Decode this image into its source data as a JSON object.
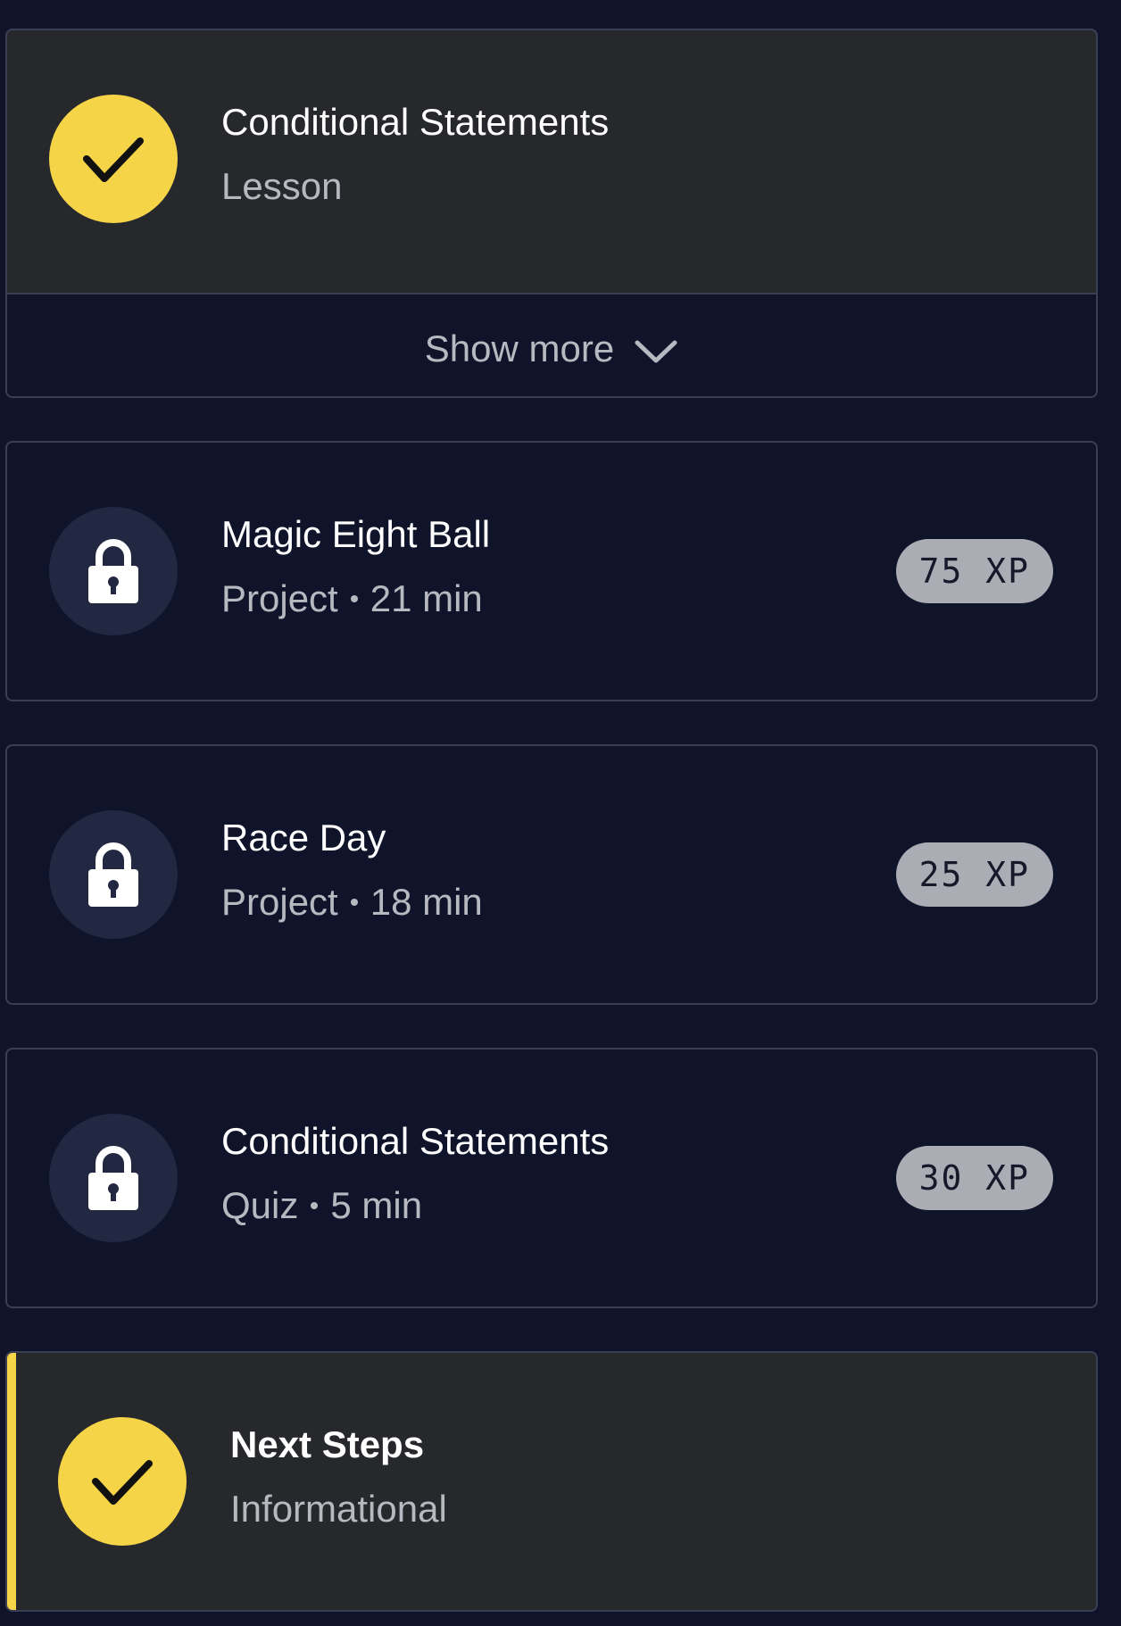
{
  "colors": {
    "page_bg": "#10142a",
    "completed_card_bg": "#27282c",
    "accent_yellow": "#f5d547",
    "lock_circle_bg": "#232842",
    "xp_badge_bg": "#acadb4",
    "border": "#3a3f55"
  },
  "items": [
    {
      "title": "Conditional Statements",
      "subtitle": "Lesson",
      "status": "completed",
      "icon": "checkmark-icon"
    },
    {
      "title": "Magic Eight Ball",
      "type": "Project",
      "duration": "21 min",
      "xp": "75 XP",
      "status": "locked",
      "icon": "lock-icon"
    },
    {
      "title": "Race Day",
      "type": "Project",
      "duration": "18 min",
      "xp": "25 XP",
      "status": "locked",
      "icon": "lock-icon"
    },
    {
      "title": "Conditional Statements",
      "type": "Quiz",
      "duration": "5 min",
      "xp": "30 XP",
      "status": "locked",
      "icon": "lock-icon"
    },
    {
      "title": "Next Steps",
      "subtitle": "Informational",
      "status": "current-completed",
      "icon": "checkmark-icon"
    }
  ],
  "show_more": {
    "label": "Show more",
    "icon": "chevron-down-icon"
  }
}
